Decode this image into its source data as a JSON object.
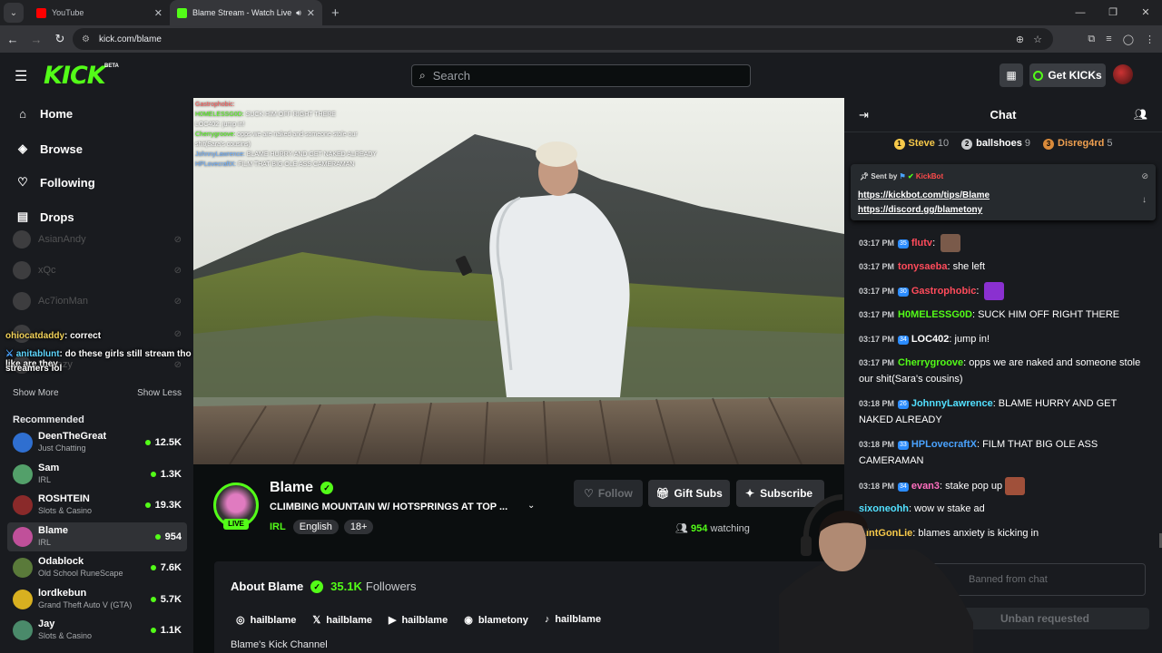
{
  "browser": {
    "tabs": [
      {
        "title": "YouTube"
      },
      {
        "title": "Blame Stream - Watch Live"
      }
    ],
    "url": "kick.com/blame"
  },
  "header": {
    "logo": "KICK",
    "beta": "BETA",
    "search_placeholder": "Search",
    "get_kicks": "Get KICKs"
  },
  "sidebar": {
    "nav": [
      {
        "label": "Home",
        "icon": "home-icon"
      },
      {
        "label": "Browse",
        "icon": "compass-icon"
      },
      {
        "label": "Following",
        "icon": "heart-icon"
      },
      {
        "label": "Drops",
        "icon": "drops-icon"
      }
    ],
    "following": [
      "AsianAndy",
      "xQc",
      "Ac7ionMan",
      "",
      "kirkrazy"
    ],
    "overlay_chat": [
      {
        "user": "ohiocatdaddy",
        "text": ": correct"
      },
      {
        "user": "anitablunt",
        "text": ": do these girls still stream tho like are they"
      },
      {
        "user": "",
        "text": "streamers lol"
      }
    ],
    "show_more": "Show More",
    "show_less": "Show Less",
    "recommended_title": "Recommended",
    "recommended": [
      {
        "name": "DeenTheGreat",
        "category": "Just Chatting",
        "viewers": "12.5K",
        "color": "#2f6fd0"
      },
      {
        "name": "Sam",
        "category": "IRL",
        "viewers": "1.3K",
        "color": "#53a06a"
      },
      {
        "name": "ROSHTEIN",
        "category": "Slots & Casino",
        "viewers": "19.3K",
        "color": "#8a2a2a"
      },
      {
        "name": "Blame",
        "category": "IRL",
        "viewers": "954",
        "color": "#c0509a"
      },
      {
        "name": "Odablock",
        "category": "Old School RuneScape",
        "viewers": "7.6K",
        "color": "#5a7a3a"
      },
      {
        "name": "lordkebun",
        "category": "Grand Theft Auto V (GTA)",
        "viewers": "5.7K",
        "color": "#d8b020"
      },
      {
        "name": "Jay",
        "category": "Slots & Casino",
        "viewers": "1.1K",
        "color": "#4a8a6a"
      }
    ]
  },
  "video_chat": [
    {
      "user": "Gastrophobic:",
      "text": "",
      "cls": "r"
    },
    {
      "user": "H0MELESSG0D:",
      "text": "SUCK HIM OFF RIGHT THERE",
      "cls": "g"
    },
    {
      "user": "LOC402:",
      "text": "jump in!",
      "cls": ""
    },
    {
      "user": "Cherrygroove:",
      "text": "opps we are naked and someone stole our shit(Sara's cousins)",
      "cls": "g"
    },
    {
      "user": "JohnnyLawrence:",
      "text": "BLAME HURRY AND GET NAKED ALREADY",
      "cls": "b"
    },
    {
      "user": "HPLovecraftX:",
      "text": "FILM THAT BIG OLE ASS CAMERAMAN",
      "cls": "b"
    }
  ],
  "stream": {
    "name": "Blame",
    "title": "CLIMBING MOUNTAIN W/ HOTSPRINGS AT TOP ...",
    "category": "IRL",
    "tags": [
      "English",
      "18+"
    ],
    "live": "LIVE",
    "follow": "Follow",
    "gift_subs": "Gift Subs",
    "subscribe": "Subscribe",
    "viewers": "954",
    "watching": "watching"
  },
  "about": {
    "title": "About Blame",
    "followers": "35.1K",
    "followers_label": "Followers",
    "socials": [
      {
        "icon": "instagram-icon",
        "glyph": "◎",
        "handle": "hailblame"
      },
      {
        "icon": "x-icon",
        "glyph": "𝕏",
        "handle": "hailblame"
      },
      {
        "icon": "youtube-icon",
        "glyph": "▶",
        "handle": "hailblame"
      },
      {
        "icon": "discord-icon",
        "glyph": "◉",
        "handle": "blametony"
      },
      {
        "icon": "tiktok-icon",
        "glyph": "♪",
        "handle": "hailblame"
      }
    ],
    "description": "Blame's Kick Channel"
  },
  "chat": {
    "title": "Chat",
    "leaderboard": [
      {
        "rank": "1",
        "name": "Steve",
        "count": "10",
        "color": "#f7c94a"
      },
      {
        "rank": "2",
        "name": "ballshoes",
        "count": "9",
        "color": "#c7c9cc"
      },
      {
        "rank": "3",
        "name": "Disreg4rd",
        "count": "5",
        "color": "#d98a3a"
      }
    ],
    "pinned": {
      "sent_by": "Sent by",
      "sender": "KickBot",
      "link1": "https://kickbot.com/tips/Blame",
      "link2": "https://discord.gg/blametony"
    },
    "messages": [
      {
        "time": "03:17 PM",
        "badge": "35",
        "user": "flutv",
        "ucls": "u-red",
        "text": "",
        "emote": "#7a5a4a"
      },
      {
        "time": "03:17 PM",
        "badge": "",
        "user": "tonysaeba",
        "ucls": "u-red",
        "text": "she left",
        "emote": ""
      },
      {
        "time": "03:17 PM",
        "badge": "30",
        "user": "Gastrophobic",
        "ucls": "u-red",
        "text": "",
        "emote": "#8a30d0"
      },
      {
        "time": "03:17 PM",
        "badge": "",
        "user": "H0MELESSG0D",
        "ucls": "u-grn",
        "text": "SUCK HIM OFF RIGHT THERE",
        "emote": ""
      },
      {
        "time": "03:17 PM",
        "badge": "34",
        "user": "LOC402",
        "ucls": "",
        "text": "jump in!",
        "emote": ""
      },
      {
        "time": "03:17 PM",
        "badge": "",
        "user": "Cherrygroove",
        "ucls": "u-grn",
        "text": "opps we are naked and someone stole our shit(Sara's cousins)",
        "emote": ""
      },
      {
        "time": "03:18 PM",
        "badge": "26",
        "user": "JohnnyLawrence",
        "ucls": "u-cy",
        "text": "BLAME HURRY AND GET NAKED ALREADY",
        "emote": ""
      },
      {
        "time": "03:18 PM",
        "badge": "33",
        "user": "HPLovecraftX",
        "ucls": "u-blue",
        "text": "FILM THAT BIG OLE ASS CAMERAMAN",
        "emote": ""
      },
      {
        "time": "03:18 PM",
        "badge": "34",
        "user": "evan3",
        "ucls": "u-pink",
        "text": "stake pop up",
        "emote": "#a0503a"
      },
      {
        "time": "",
        "badge": "",
        "user": "sixoneohh",
        "ucls": "u-cy",
        "text": "wow w stake ad",
        "emote": ""
      },
      {
        "time": "",
        "badge": "",
        "user": "AintGonLie",
        "ucls": "u-yel",
        "text": "blames anxiety is kicking in",
        "emote": ""
      }
    ],
    "input_placeholder": "Banned from chat",
    "unban": "Unban requested"
  }
}
